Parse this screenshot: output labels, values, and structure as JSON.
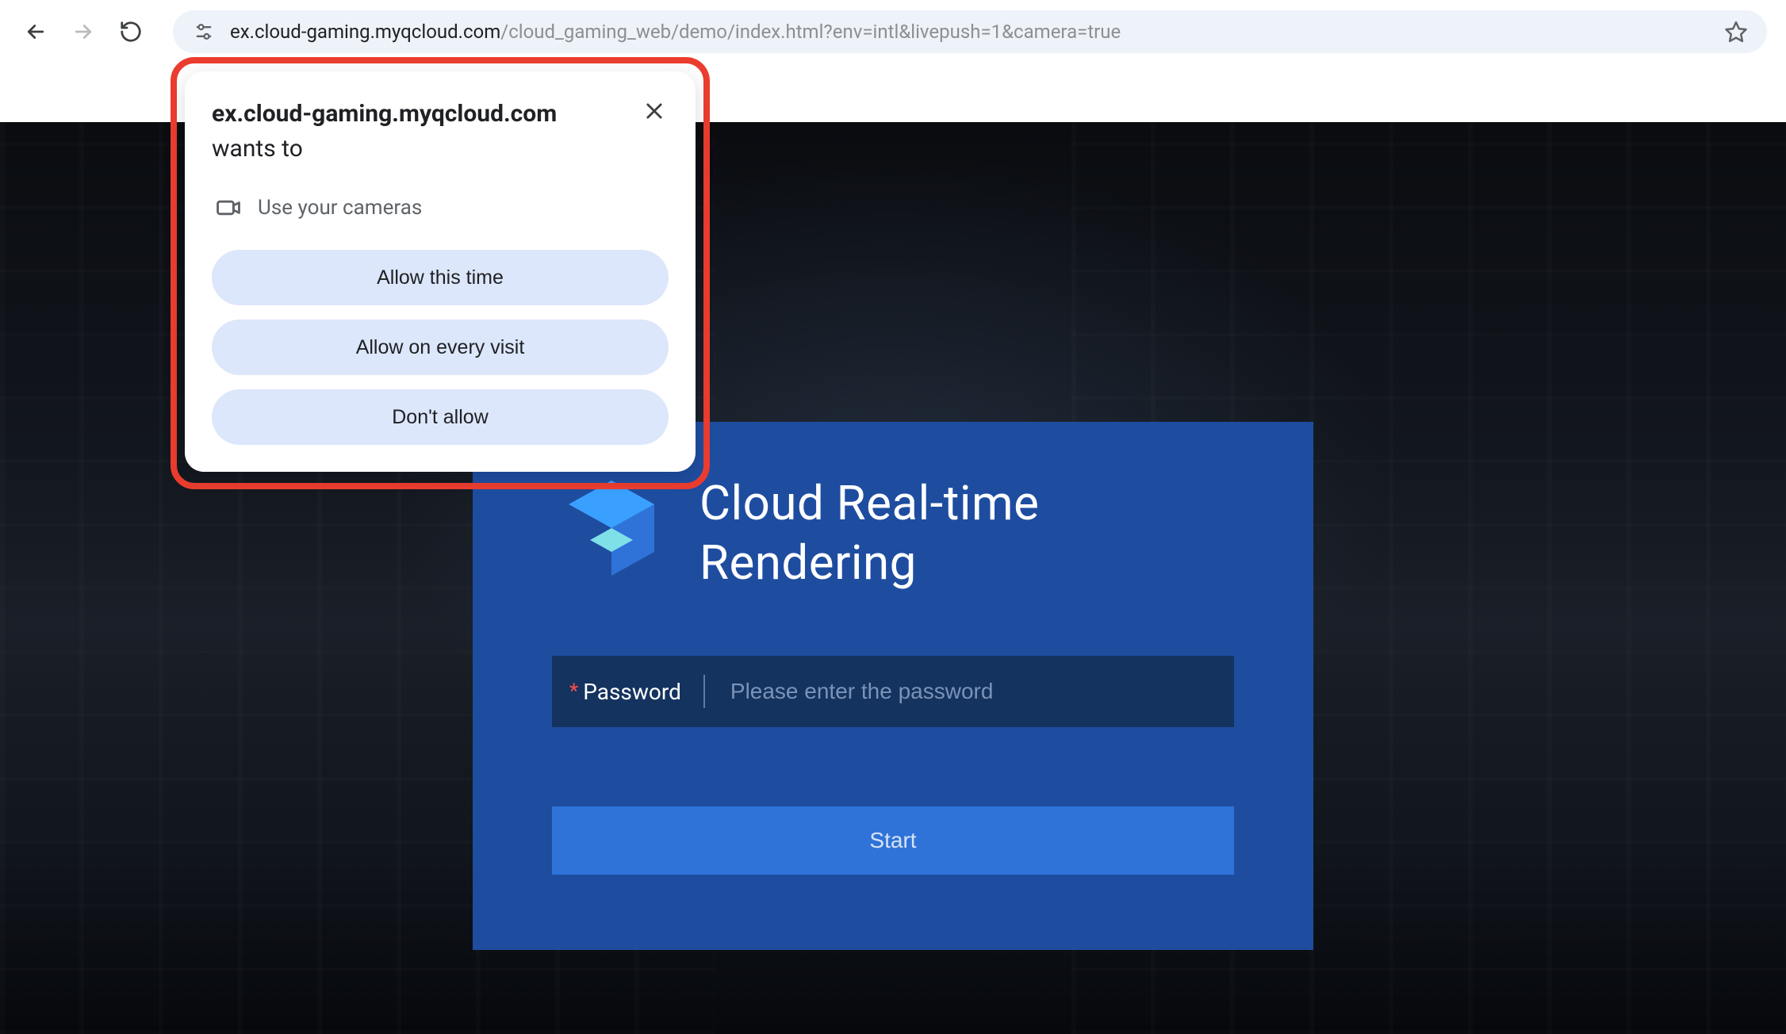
{
  "browser": {
    "url_host": "ex.cloud-gaming.myqcloud.com",
    "url_path": "/cloud_gaming_web/demo/index.html?env=intl&livepush=1&camera=true"
  },
  "permission": {
    "origin": "ex.cloud-gaming.myqcloud.com",
    "suffix": " wants to",
    "camera_label": "Use your cameras",
    "allow_once": "Allow this time",
    "allow_always": "Allow on every visit",
    "deny": "Don't allow"
  },
  "login": {
    "title_line1": "Cloud Real-time",
    "title_line2": "Rendering",
    "asterisk": "*",
    "password_label": "Password",
    "password_placeholder": "Please enter the password",
    "start": "Start"
  }
}
